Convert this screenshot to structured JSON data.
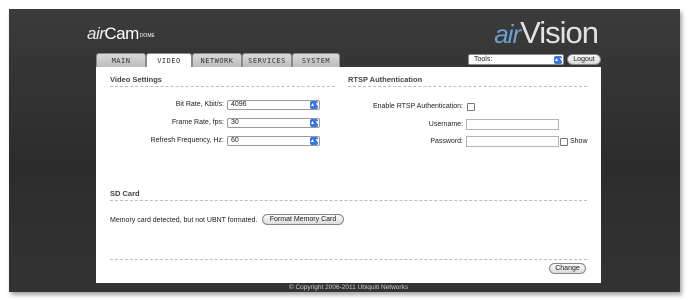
{
  "brand": {
    "prefix": "air",
    "name": "Cam",
    "suffix": "DOME"
  },
  "logo": {
    "prefix": "air",
    "name": "Vision"
  },
  "tabs": [
    {
      "label": "MAIN"
    },
    {
      "label": "VIDEO"
    },
    {
      "label": "NETWORK"
    },
    {
      "label": "SERVICES"
    },
    {
      "label": "SYSTEM"
    }
  ],
  "header": {
    "tools_label": "Tools:",
    "logout_label": "Logout"
  },
  "video_settings": {
    "title": "Video Settings",
    "bitrate_label": "Bit Rate, Kbit/s:",
    "bitrate_value": "4096",
    "framerate_label": "Frame Rate, fps:",
    "framerate_value": "30",
    "refresh_label": "Refresh Frequency, Hz:",
    "refresh_value": "60"
  },
  "rtsp": {
    "title": "RTSP Authentication",
    "enable_label": "Enable RTSP Authentication:",
    "username_label": "Username:",
    "password_label": "Password:",
    "show_label": "Show"
  },
  "sd_card": {
    "title": "SD Card",
    "status_text": "Memory card detected, but not UBNT formated.",
    "format_button": "Format Memory Card"
  },
  "actions": {
    "change_button": "Change"
  },
  "footer": {
    "copyright": "© Copyright 2006-2011 Ubiquiti Networks"
  },
  "colors": {
    "accent": "#3c78d8",
    "frame": "#333333",
    "logo_accent": "#6b9fcf"
  }
}
